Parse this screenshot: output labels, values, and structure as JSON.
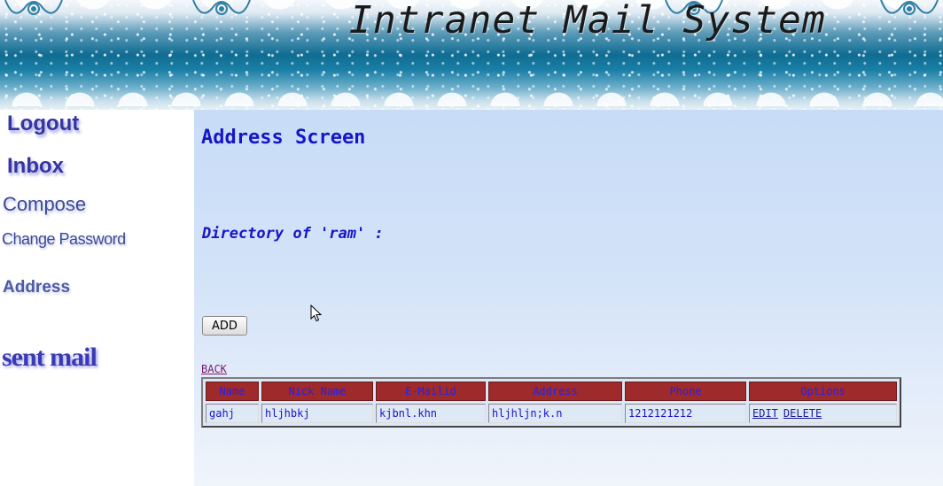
{
  "header": {
    "title": "Intranet Mail System"
  },
  "sidebar": {
    "items": [
      {
        "label": "Logout"
      },
      {
        "label": "Inbox"
      },
      {
        "label": "Compose"
      },
      {
        "label": "Change Password"
      },
      {
        "label": "Address"
      },
      {
        "label": "sent mail"
      }
    ]
  },
  "main": {
    "title": "Address Screen",
    "directory_label": "Directory of 'ram' :",
    "add_button": "ADD",
    "back_link": "BACK",
    "table": {
      "columns": [
        "Name",
        "Nick Name",
        "E-Mailid",
        "Address",
        "Phone",
        "Options"
      ],
      "rows": [
        {
          "name": "gahj",
          "nick_name": "hljhbkj",
          "email": "kjbnl.khn",
          "address": "hljhljn;k.n",
          "phone": "1212121212",
          "edit": "EDIT",
          "delete": "DELETE"
        }
      ]
    }
  },
  "colors": {
    "header_cell": "#9e2a2b",
    "accent_text": "#1616c8",
    "nav_text": "#3434a4"
  }
}
